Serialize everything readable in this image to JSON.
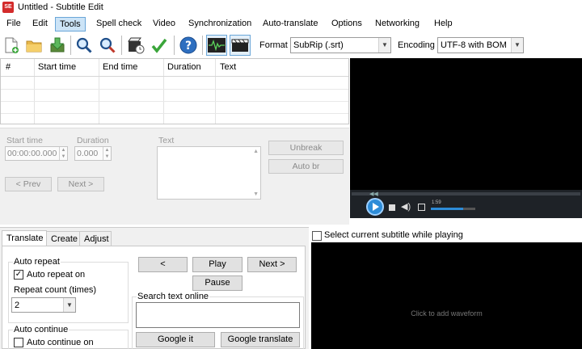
{
  "window": {
    "title": "Untitled - Subtitle Edit",
    "icon_text": "SE"
  },
  "menu": {
    "items": [
      "File",
      "Edit",
      "Tools",
      "Spell check",
      "Video",
      "Synchronization",
      "Auto-translate",
      "Options",
      "Networking",
      "Help"
    ],
    "active": "Tools"
  },
  "toolbar": {
    "icons": [
      "new-file-icon",
      "open-folder-icon",
      "save-download-icon",
      "find-icon",
      "replace-icon",
      "visual-sync-icon",
      "spell-check-icon",
      "help-icon",
      "waveform-toggle-icon",
      "video-toggle-icon"
    ],
    "format_label": "Format",
    "format_value": "SubRip (.srt)",
    "encoding_label": "Encoding",
    "encoding_value": "UTF-8 with BOM"
  },
  "grid": {
    "columns": [
      "#",
      "Start time",
      "End time",
      "Duration",
      "Text"
    ]
  },
  "edit": {
    "start_time_label": "Start time",
    "start_time_value": "00:00:00.000",
    "duration_label": "Duration",
    "duration_value": "0.000",
    "text_label": "Text",
    "unbreak_label": "Unbreak",
    "auto_br_label": "Auto br",
    "prev_label": "< Prev",
    "next_label": "Next >"
  },
  "video": {
    "time_readout": "1:59",
    "colors": {
      "bg": "#000000",
      "controls": "#1e2227",
      "progress": "#2d8cd8"
    }
  },
  "tabs": {
    "items": [
      "Translate",
      "Create",
      "Adjust"
    ],
    "active": "Translate"
  },
  "translate": {
    "auto_repeat_group": "Auto repeat",
    "auto_repeat_on": "Auto repeat on",
    "auto_repeat_checked": true,
    "repeat_count_label": "Repeat count (times)",
    "repeat_count_value": "2",
    "auto_continue_group": "Auto continue",
    "auto_continue_on": "Auto continue on",
    "auto_continue_checked": false,
    "back_label": "<",
    "play_label": "Play",
    "next_label": "Next >",
    "pause_label": "Pause",
    "search_label": "Search text online",
    "google_it": "Google it",
    "google_translate": "Google translate"
  },
  "waveform": {
    "select_current_label": "Select current subtitle while playing",
    "placeholder": "Click to add waveform"
  }
}
